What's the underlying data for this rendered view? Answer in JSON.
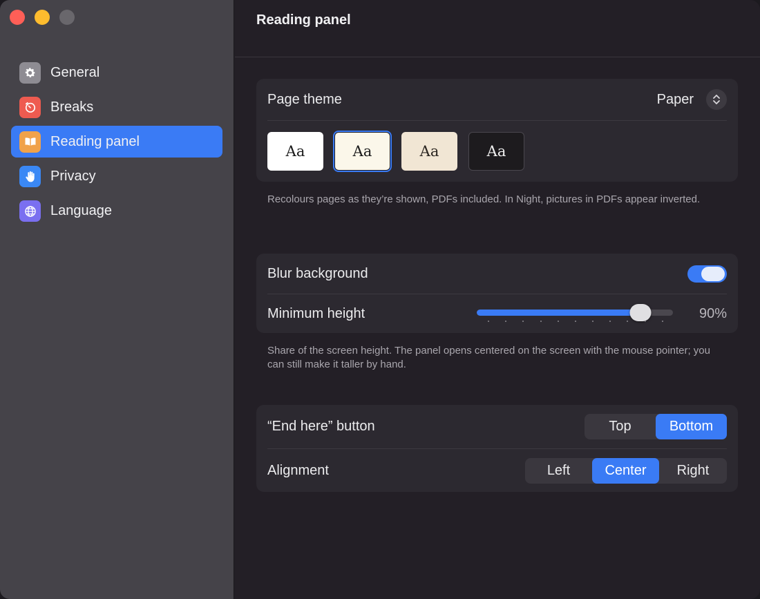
{
  "sidebar": {
    "items": [
      {
        "label": "General",
        "icon": "gear-icon",
        "color": "#8e8c93",
        "active": false
      },
      {
        "label": "Breaks",
        "icon": "timer-icon",
        "color": "#ee5b50",
        "active": false
      },
      {
        "label": "Reading panel",
        "icon": "book-icon",
        "color": "#f0a24a",
        "active": true
      },
      {
        "label": "Privacy",
        "icon": "hand-icon",
        "color": "#3a88f5",
        "active": false
      },
      {
        "label": "Language",
        "icon": "globe-icon",
        "color": "#7a6ff0",
        "active": false
      }
    ]
  },
  "header": {
    "title": "Reading panel"
  },
  "page_theme": {
    "label": "Page theme",
    "selected": "Paper",
    "swatches": [
      {
        "text": "Aa",
        "bg": "#ffffff",
        "fg": "#1a1a1a",
        "selected": false
      },
      {
        "text": "Aa",
        "bg": "#fbf7ea",
        "fg": "#1a1a1a",
        "selected": true
      },
      {
        "text": "Aa",
        "bg": "#f1e6d4",
        "fg": "#2a2520",
        "selected": false
      },
      {
        "text": "Aa",
        "bg": "#1d1b1e",
        "fg": "#f0f0f0",
        "selected": false
      }
    ],
    "note": "Recolours pages as they’re shown, PDFs included. In Night, pictures in PDFs appear inverted."
  },
  "layout": {
    "blur_label": "Blur background",
    "blur_on": true,
    "min_height_label": "Minimum height",
    "min_height_value": 90,
    "min_height_display": "90%",
    "note": "Share of the screen height. The panel opens centered on the screen with the mouse pointer; you can still make it taller by hand."
  },
  "buttons": {
    "end_here_label": "“End here” button",
    "end_here_options": [
      "Top",
      "Bottom"
    ],
    "end_here_selected": "Bottom",
    "alignment_label": "Alignment",
    "alignment_options": [
      "Left",
      "Center",
      "Right"
    ],
    "alignment_selected": "Center"
  },
  "colors": {
    "accent": "#3a7bf5"
  }
}
